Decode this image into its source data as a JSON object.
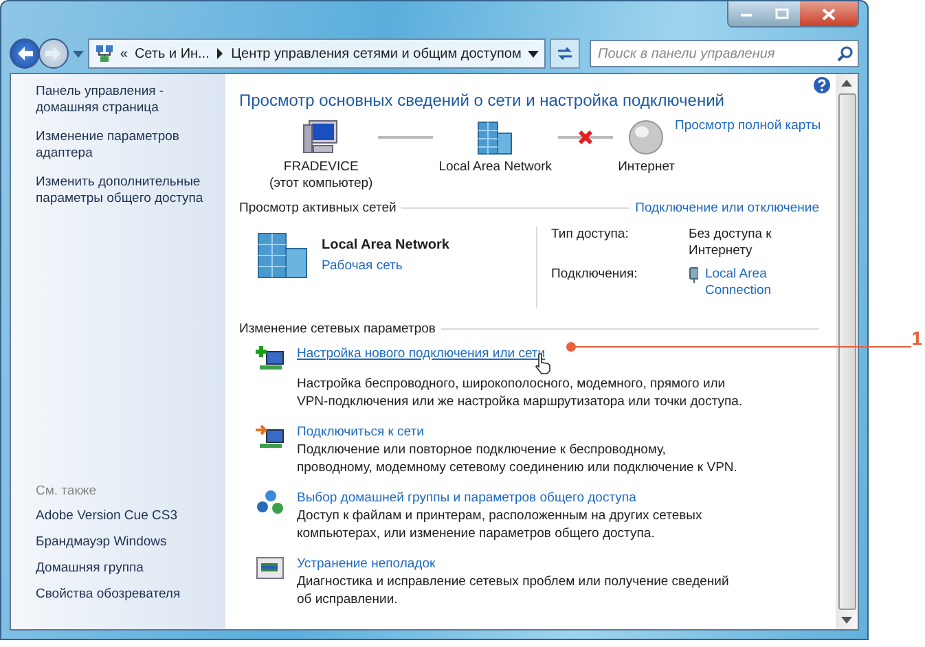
{
  "address_bar": {
    "chevron": "«",
    "segments": [
      "Сеть и Ин...",
      "Центр управления сетями и общим доступом"
    ]
  },
  "search": {
    "placeholder": "Поиск в панели управления"
  },
  "sidebar": {
    "links": [
      "Панель управления - домашняя страница",
      "Изменение параметров адаптера",
      "Изменить дополнительные параметры общего доступа"
    ],
    "see_also_title": "См. также",
    "see_also": [
      "Adobe Version Cue CS3",
      "Брандмауэр Windows",
      "Домашняя группа",
      "Свойства обозревателя"
    ]
  },
  "title": "Просмотр основных сведений о сети и настройка подключений",
  "map_link": "Просмотр полной карты",
  "map": [
    {
      "kind": "computer",
      "label_lines": [
        "FRADEVICE",
        "(этот компьютер)"
      ]
    },
    {
      "kind": "network",
      "label_lines": [
        "Local Area Network"
      ]
    },
    {
      "kind": "internet",
      "label_lines": [
        "Интернет"
      ]
    }
  ],
  "map_links": [
    {
      "broken": false
    },
    {
      "broken": true
    }
  ],
  "active_networks": {
    "title": "Просмотр активных сетей",
    "action": "Подключение или отключение",
    "network": {
      "name": "Local Area Network",
      "type": "Рабочая сеть"
    },
    "details": [
      {
        "label": "Тип доступа:",
        "value": "Без доступа к Интернету",
        "kind": "text"
      },
      {
        "label": "Подключения:",
        "value": "Local Area Connection",
        "kind": "link"
      }
    ]
  },
  "change_settings": {
    "title": "Изменение сетевых параметров",
    "tasks": [
      {
        "kind": "new",
        "link": "Настройка нового подключения или сети",
        "description": "Настройка беспроводного, широкополосного, модемного, прямого или VPN-подключения или же настройка маршрутизатора или точки доступа.",
        "hovered": true
      },
      {
        "kind": "connect",
        "link": "Подключиться к сети",
        "description": "Подключение или повторное подключение к беспроводному, проводному, модемному сетевому соединению или подключение к VPN.",
        "hovered": false
      },
      {
        "kind": "homegroup",
        "link": "Выбор домашней группы и параметров общего доступа",
        "description": "Доступ к файлам и принтерам, расположенным на других сетевых компьютерах, или изменение параметров общего доступа.",
        "hovered": false
      },
      {
        "kind": "troubleshoot",
        "link": "Устранение неполадок",
        "description": "Диагностика и исправление сетевых проблем или получение сведений об исправлении.",
        "hovered": false
      }
    ]
  },
  "callout": {
    "label": "1"
  }
}
